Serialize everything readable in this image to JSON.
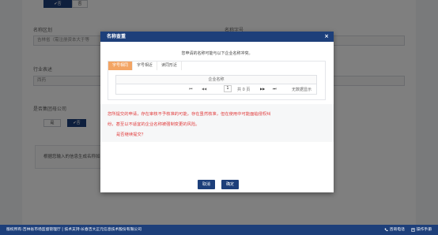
{
  "background": {
    "top_toggle": {
      "yes": "✔否",
      "no": "否"
    },
    "name_zone": {
      "label": "名称区划",
      "value": "吉林省（需注册资本大于等"
    },
    "name_prefix_label": "名称字号",
    "industry": {
      "label": "行业表述",
      "value": "西药"
    },
    "group_question": "是否集团母公司",
    "group_toggle": {
      "no": "是",
      "yes": "✔否"
    },
    "note": "根据您输入的信息生成名称如"
  },
  "dialog": {
    "title": "名称查重",
    "close": "×",
    "subtitle": "您申请的名称可能与以下企业名称冲突。",
    "tabs": [
      {
        "label": "字号相同",
        "active": true
      },
      {
        "label": "字号相近",
        "active": false
      },
      {
        "label": "读同形近",
        "active": false
      }
    ],
    "table_header": "企业名称",
    "pager": {
      "first": "⏮",
      "prev": "◀◀",
      "page": "1",
      "total": "共 0 页",
      "next": "▶▶",
      "last": "⏭",
      "empty": "无数据显示"
    },
    "warning_lines": [
      "您所提交的申请，存在审核不予核准的可能，存在虽然核准，但在使用中可能面临侵权纠",
      "纷，甚至以不适宜的企业名称被强制变更的风险。",
      "是否继续提交？"
    ],
    "cancel": "取消",
    "confirm": "确定"
  },
  "footer": {
    "copyright": "版权所有:吉林省市场监督管理厅 | 技术支持:长春吉大正元信息技术股份有限公司",
    "hotline": "咨询电话",
    "manual": "操作手册"
  },
  "colors": {
    "primary": "#1d3f7a",
    "tab_active": "#f3a564",
    "warning": "#e03a3a"
  }
}
